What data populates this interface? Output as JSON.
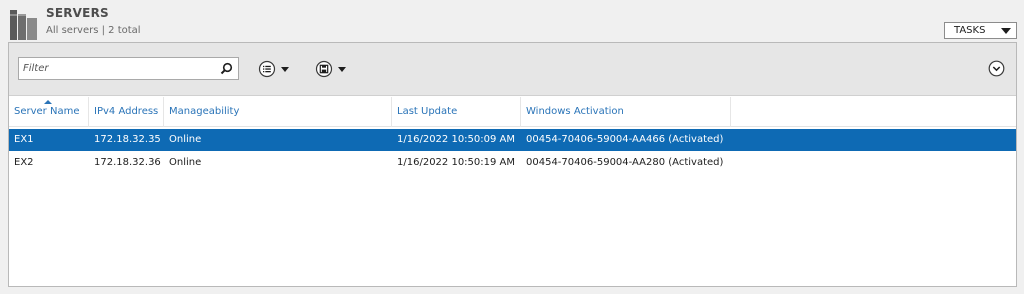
{
  "header": {
    "title": "SERVERS",
    "subtitle": "All servers | 2 total",
    "tasks_label": "TASKS"
  },
  "toolbar": {
    "filter_placeholder": "Filter"
  },
  "grid": {
    "columns": [
      "Server Name",
      "IPv4 Address",
      "Manageability",
      "Last Update",
      "Windows Activation"
    ],
    "sorted_column": "Server Name",
    "rows": [
      {
        "name": "EX1",
        "ip": "172.18.32.35",
        "manageability": "Online",
        "last_update": "1/16/2022 10:50:09 AM",
        "activation": "00454-70406-59004-AA466 (Activated)",
        "selected": true
      },
      {
        "name": "EX2",
        "ip": "172.18.32.36",
        "manageability": "Online",
        "last_update": "1/16/2022 10:50:19 AM",
        "activation": "00454-70406-59004-AA280 (Activated)",
        "selected": false
      }
    ]
  },
  "colors": {
    "selection": "#0e6ab4",
    "header_link": "#2a74b8"
  }
}
